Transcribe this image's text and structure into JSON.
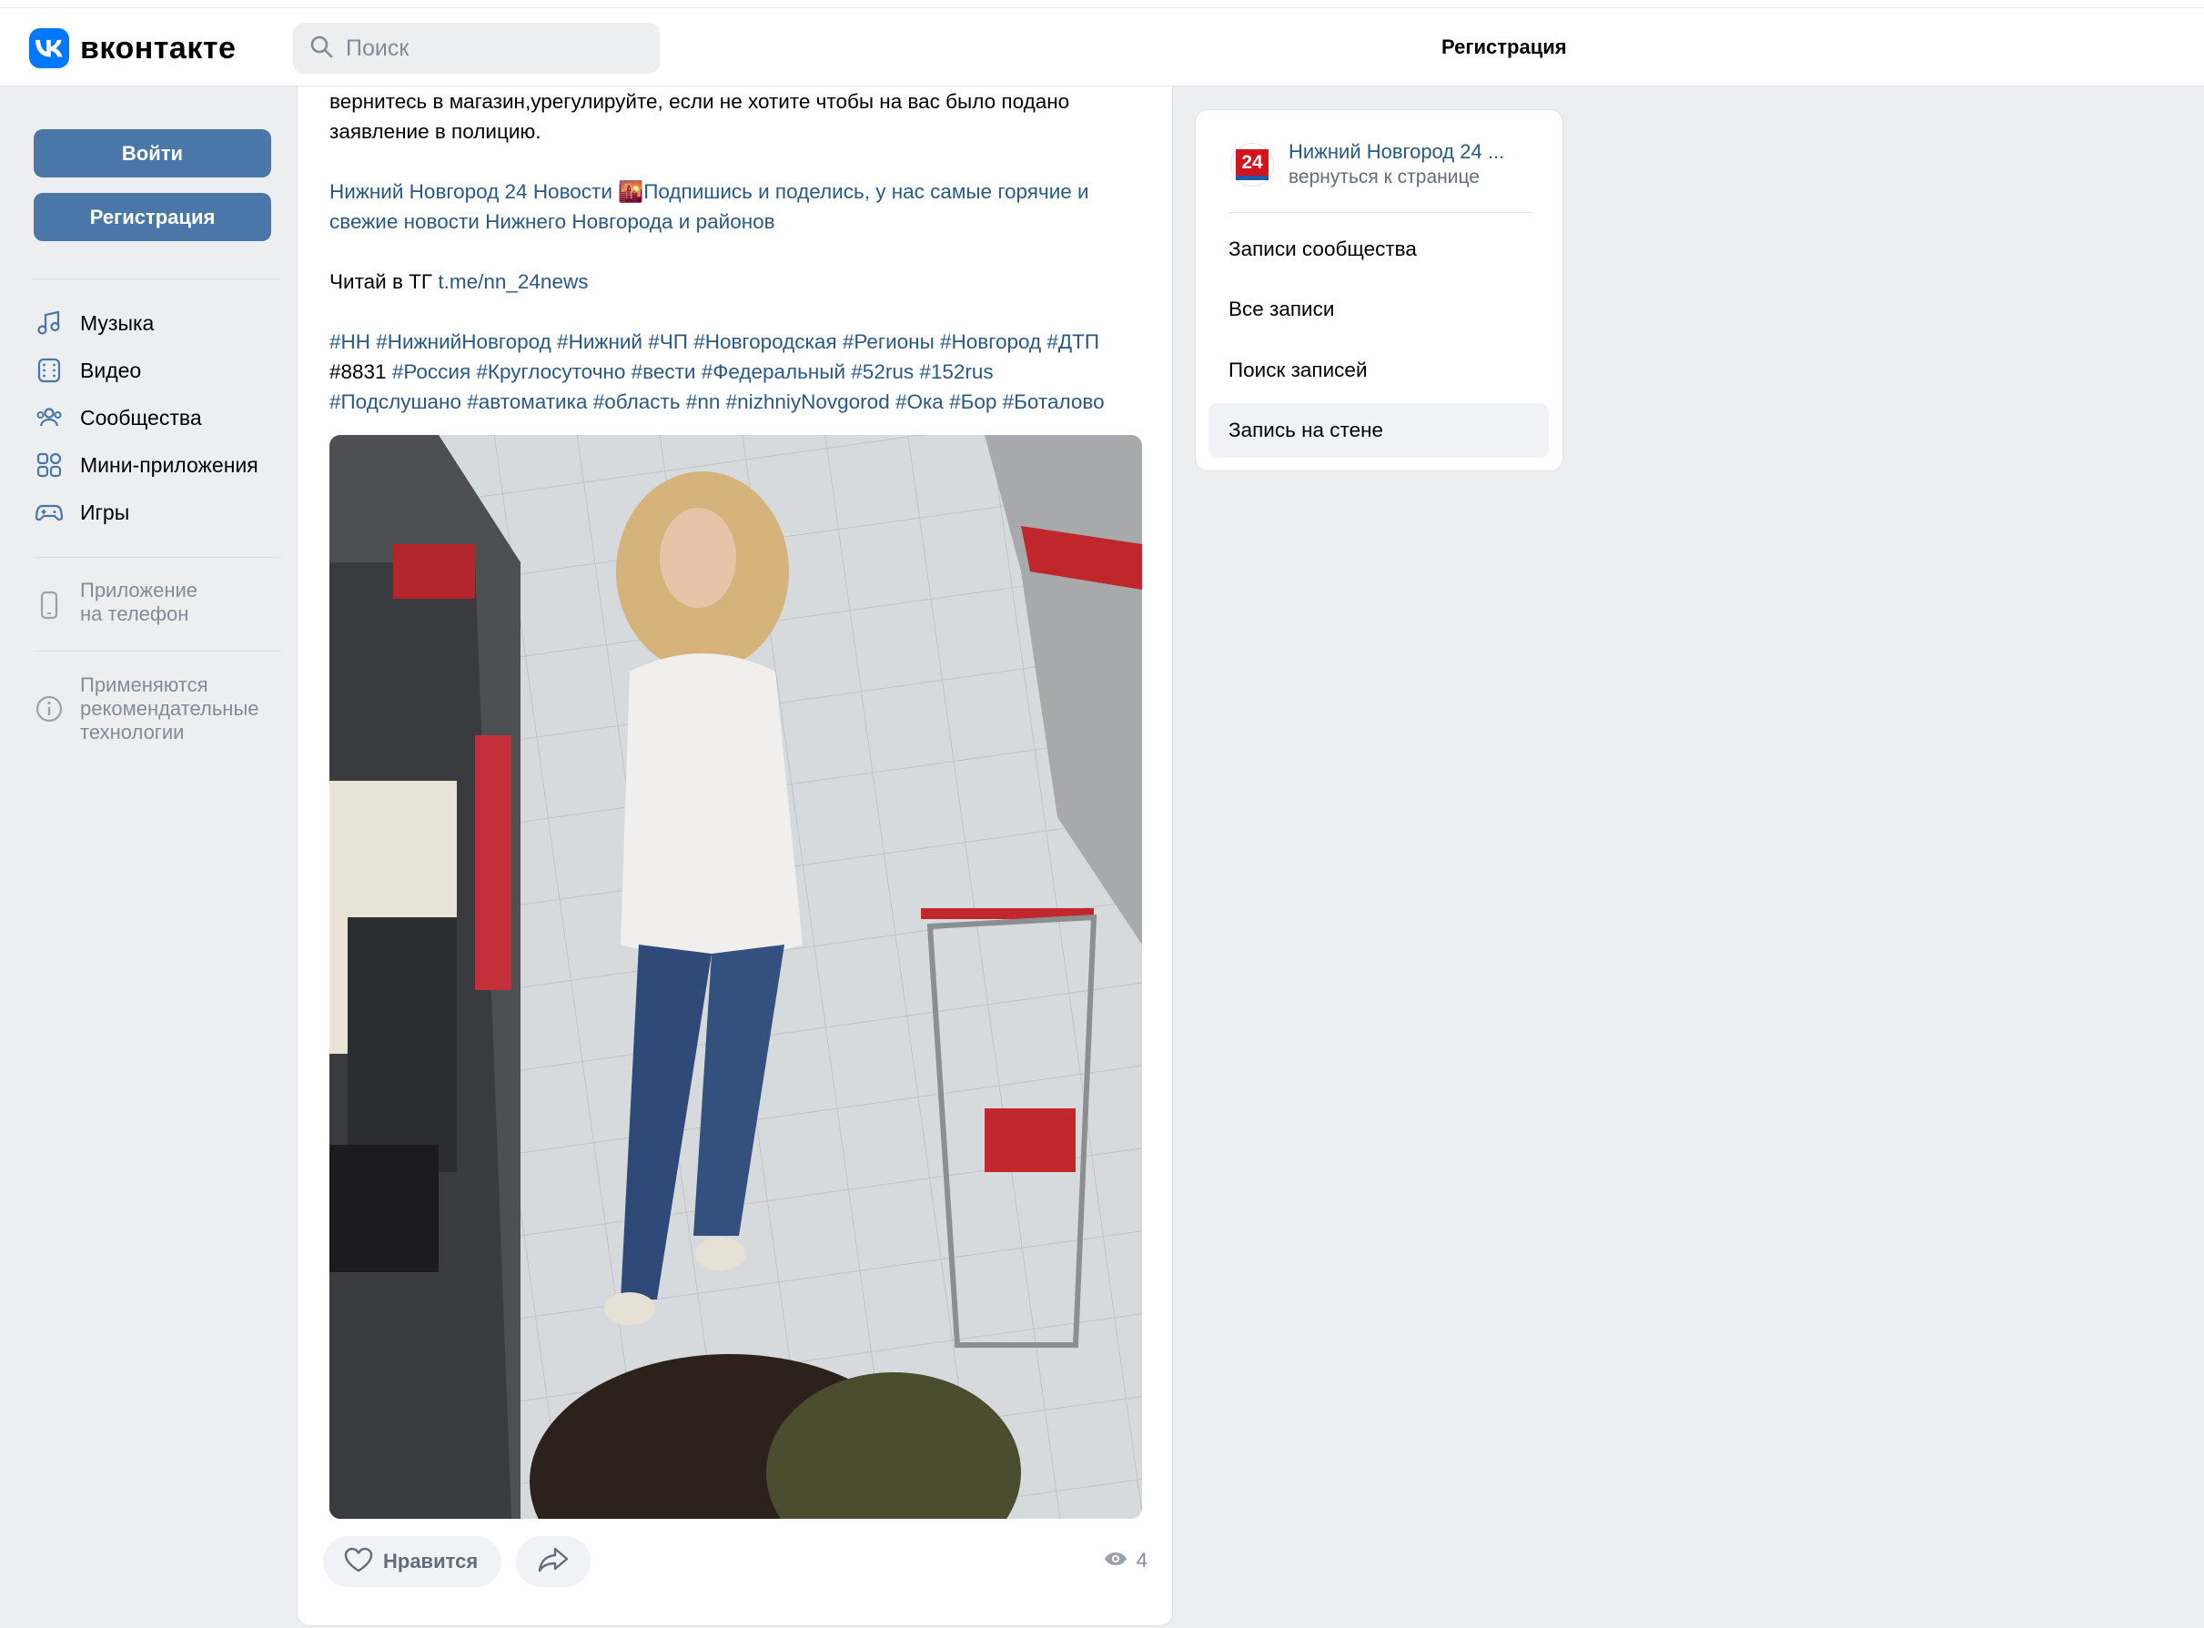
{
  "header": {
    "logo_text": "вконтакте",
    "search_placeholder": "Поиск",
    "register_link": "Регистрация"
  },
  "sidebar": {
    "login_button": "Войти",
    "register_button": "Регистрация",
    "nav": [
      {
        "label": "Музыка",
        "icon": "music-icon"
      },
      {
        "label": "Видео",
        "icon": "video-icon"
      },
      {
        "label": "Сообщества",
        "icon": "communities-icon"
      },
      {
        "label": "Мини-приложения",
        "icon": "mini-apps-icon"
      },
      {
        "label": "Игры",
        "icon": "games-icon"
      }
    ],
    "phone_app": {
      "line1": "Приложение",
      "line2": "на телефон"
    },
    "recommend": {
      "line1": "Применяются",
      "line2": "рекомендательные",
      "line3": "технологии"
    }
  },
  "post": {
    "text_line1": "вернитесь в магазин,урегулируйте, если не хотите чтобы на вас было подано",
    "text_line2": "заявление в полицию.",
    "promo_link": "Нижний Новгород 24 Новости",
    "promo_emoji": "🌇",
    "promo_text_line1": "Подпишись и поделись, у нас самые горячие и",
    "promo_text_line2": "свежие новости Нижнего Новгорода и районов",
    "tg_prefix": "Читай в ТГ",
    "tg_link": "t.me/nn_24news",
    "hashtags_line1": "#НН #НижнийНовгород #Нижний #ЧП #Новгородская #Регионы #Новгород #ДТП",
    "hashtags_line2_plain": "#8831",
    "hashtags_line2_links": "#Россия #Круглосуточно #вести #Федеральный #52rus #152rus",
    "hashtags_line3": "#Подслушано #автоматика #область #nn #nizhniyNovgorod #Ока #Бор #Боталово",
    "like_label": "Нравится",
    "views": "4"
  },
  "right_panel": {
    "group_logo_text": "24",
    "group_name": "Нижний Новгород 24 ...",
    "group_back": "вернуться к странице",
    "menu": [
      "Записи сообщества",
      "Все записи",
      "Поиск записей",
      "Запись на стене"
    ]
  },
  "colors": {
    "accent": "#4a76a8",
    "link": "#2a5885",
    "vk_blue": "#0077ff",
    "background": "#edeef0"
  }
}
